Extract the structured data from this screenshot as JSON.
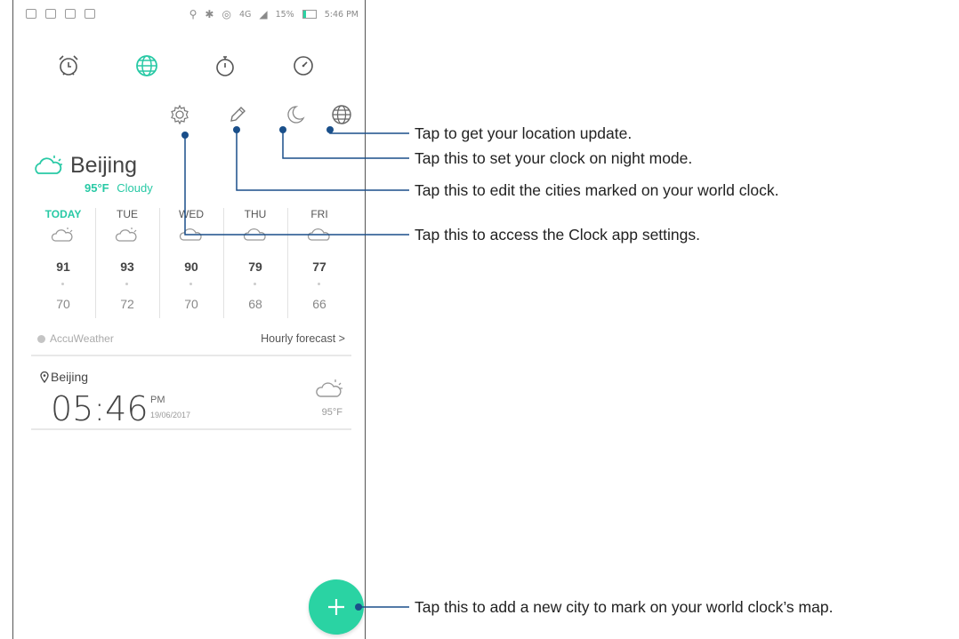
{
  "status_bar": {
    "battery_level": "15%",
    "time": "5:46 PM",
    "network": "4G"
  },
  "tabs": [
    {
      "name": "alarm",
      "icon": "alarm-clock-icon",
      "active": false
    },
    {
      "name": "world-clock",
      "icon": "globe-icon",
      "active": true
    },
    {
      "name": "stopwatch",
      "icon": "stopwatch-icon",
      "active": false
    },
    {
      "name": "timer",
      "icon": "timer-icon",
      "active": false
    }
  ],
  "actions": [
    {
      "name": "settings",
      "icon": "gear-icon"
    },
    {
      "name": "edit",
      "icon": "pencil-icon"
    },
    {
      "name": "night-mode",
      "icon": "moon-icon"
    },
    {
      "name": "location",
      "icon": "globe-icon"
    }
  ],
  "weather": {
    "city": "Beijing",
    "current_temp": "95°F",
    "condition": "Cloudy",
    "days": [
      {
        "label": "TODAY",
        "high": "91",
        "low": "70",
        "icon": "partly-cloudy-icon"
      },
      {
        "label": "TUE",
        "high": "93",
        "low": "72",
        "icon": "partly-cloudy-icon"
      },
      {
        "label": "WED",
        "high": "90",
        "low": "70",
        "icon": "cloud-icon"
      },
      {
        "label": "THU",
        "high": "79",
        "low": "68",
        "icon": "cloud-icon"
      },
      {
        "label": "FRI",
        "high": "77",
        "low": "66",
        "icon": "cloud-icon"
      }
    ],
    "provider": "AccuWeather",
    "hourly_link": "Hourly forecast >"
  },
  "clock_card": {
    "city": "Beijing",
    "time": "05:46",
    "ampm": "PM",
    "date": "19/06/2017",
    "temp": "95°F"
  },
  "colors": {
    "accent": "#28c9a5",
    "fab": "#2ad3a3",
    "callout_line": "#1a4f8a"
  },
  "callouts": {
    "location": "Tap to get your location update.",
    "night_mode": "Tap this to set your clock on night mode.",
    "edit": "Tap this to edit the cities marked on your world clock.",
    "settings": "Tap this to access the Clock app settings.",
    "add_city": "Tap this to add a new city to mark on your world clock’s map."
  }
}
